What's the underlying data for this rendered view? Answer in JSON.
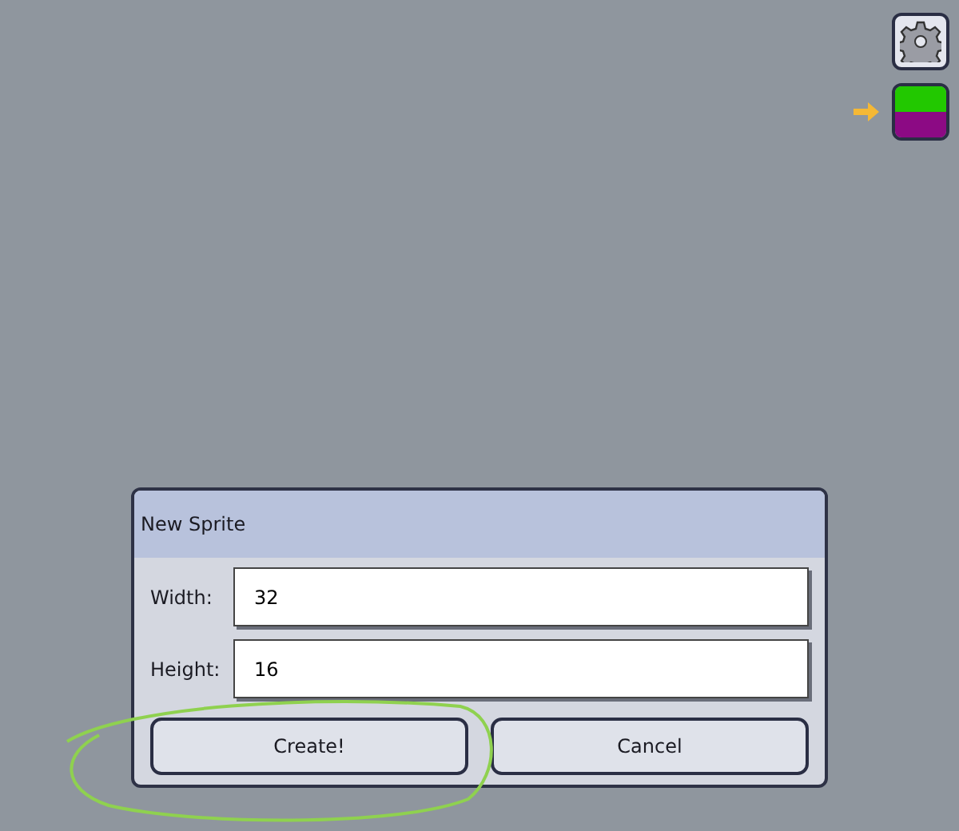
{
  "toolbar": {
    "palette": [
      {
        "color": "#22c800"
      },
      {
        "color": "#8c0a84"
      }
    ]
  },
  "dialog": {
    "title": "New Sprite",
    "fields": [
      {
        "label": "Width:",
        "value": "32"
      },
      {
        "label": "Height:",
        "value": "16"
      }
    ],
    "buttons": [
      "Create!",
      "Cancel"
    ]
  }
}
